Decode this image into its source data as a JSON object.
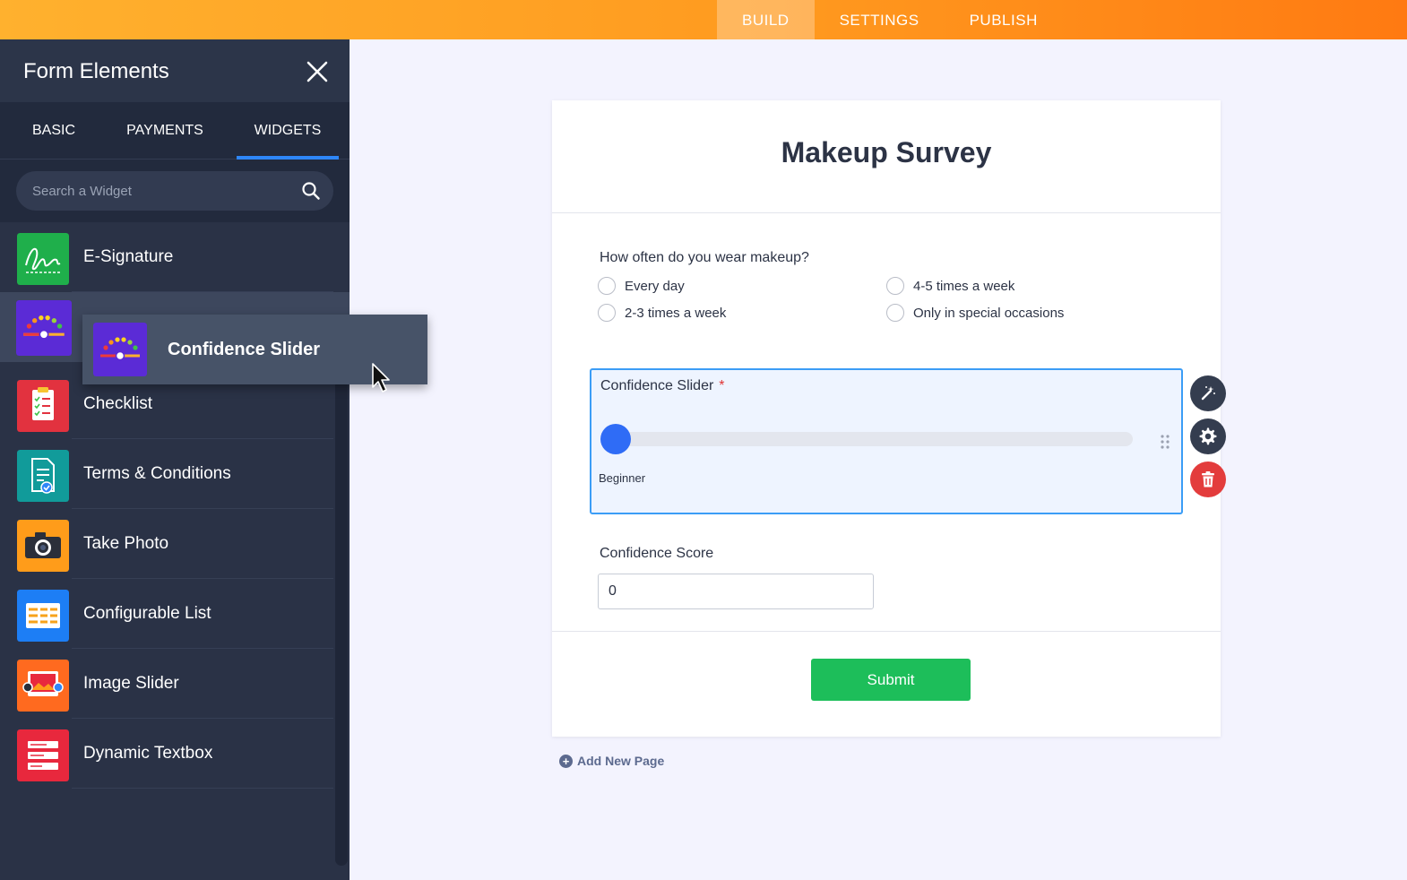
{
  "topnav": {
    "tabs": [
      {
        "label": "BUILD",
        "active": true
      },
      {
        "label": "SETTINGS"
      },
      {
        "label": "PUBLISH"
      }
    ]
  },
  "panel": {
    "title": "Form Elements",
    "tabs": [
      {
        "label": "BASIC"
      },
      {
        "label": "PAYMENTS"
      },
      {
        "label": "WIDGETS",
        "active": true
      }
    ],
    "search_placeholder": "Search a Widget",
    "items": [
      {
        "label": "E-Signature",
        "icon": "signature-icon",
        "color": "#1faf4b"
      },
      {
        "label": "",
        "icon": "confidence-slider-icon",
        "color": "#5b2bd6",
        "hidden_by_drag": true
      },
      {
        "label": "Checklist",
        "icon": "checklist-icon",
        "color": "#e2323f"
      },
      {
        "label": "Terms & Conditions",
        "icon": "terms-icon",
        "color": "#119b9a"
      },
      {
        "label": "Take Photo",
        "icon": "camera-icon",
        "color": "#ff9c1a"
      },
      {
        "label": "Configurable List",
        "icon": "configurable-list-icon",
        "color": "#1d7ef5"
      },
      {
        "label": "Image Slider",
        "icon": "image-slider-icon",
        "color": "#ff6a1f"
      },
      {
        "label": "Dynamic Textbox",
        "icon": "dynamic-textbox-icon",
        "color": "#e8283d"
      }
    ]
  },
  "drag": {
    "label": "Confidence Slider",
    "icon": "confidence-slider-icon"
  },
  "form": {
    "title": "Makeup Survey",
    "question": "How often do you wear makeup?",
    "options": [
      "Every day",
      "4-5 times a week",
      "2-3 times a week",
      "Only in special occasions"
    ],
    "slider": {
      "label": "Confidence Slider",
      "required_mark": "*",
      "value_label": "Beginner",
      "value_fraction": 0
    },
    "score": {
      "label": "Confidence Score",
      "value": "0"
    },
    "submit": "Submit"
  },
  "add_page": "Add New Page",
  "colors": {
    "accent": "#2e86f8",
    "submit": "#1dbe5a",
    "delete": "#e33c3c",
    "slider_thumb": "#2f6cf6"
  }
}
